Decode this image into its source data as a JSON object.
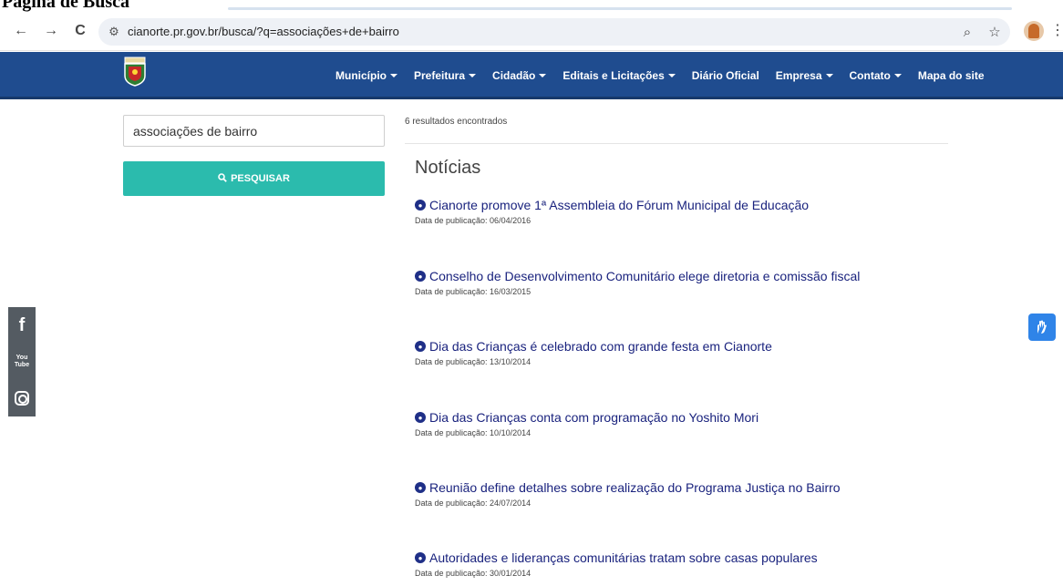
{
  "browser": {
    "tab_title": "Página de Busca",
    "url": "cianorte.pr.gov.br/busca/?q=associações+de+bairro",
    "back_icon": "←",
    "forward_icon": "→",
    "reload_icon": "C",
    "site_info_icon": "⚙",
    "zoom_icon": "⌕",
    "bookmark_icon": "☆",
    "menu_icon": "⋮"
  },
  "header": {
    "nav": [
      {
        "label": "Município",
        "dropdown": true
      },
      {
        "label": "Prefeitura",
        "dropdown": true
      },
      {
        "label": "Cidadão",
        "dropdown": true
      },
      {
        "label": "Editais e Licitações",
        "dropdown": true
      },
      {
        "label": "Diário Oficial",
        "dropdown": false
      },
      {
        "label": "Empresa",
        "dropdown": true
      },
      {
        "label": "Contato",
        "dropdown": true
      },
      {
        "label": "Mapa do site",
        "dropdown": false
      }
    ],
    "colors": {
      "bar": "#1f4c8f"
    }
  },
  "search": {
    "value": "associações de bairro",
    "button_label": "PESQUISAR",
    "button_color": "#2bbbad"
  },
  "results": {
    "count_text": "6 resultados encontrados",
    "section_title": "Notícias",
    "items": [
      {
        "title": "Cianorte promove 1ª Assembleia do Fórum Municipal de Educação",
        "date": "Data de publicação: 06/04/2016"
      },
      {
        "title": "Conselho de Desenvolvimento Comunitário elege diretoria e comissão fiscal",
        "date": "Data de publicação: 16/03/2015"
      },
      {
        "title": "Dia das Crianças é celebrado com grande festa em Cianorte",
        "date": "Data de publicação: 13/10/2014"
      },
      {
        "title": "Dia das Crianças conta com programação no Yoshito Mori",
        "date": "Data de publicação: 10/10/2014"
      },
      {
        "title": "Reunião define detalhes sobre realização do Programa Justiça no Bairro",
        "date": "Data de publicação: 24/07/2014"
      },
      {
        "title": "Autoridades e lideranças comunitárias tratam sobre casas populares",
        "date": "Data de publicação: 30/01/2014"
      }
    ]
  },
  "social": {
    "facebook_glyph": "f",
    "youtube_glyph_top": "You",
    "youtube_glyph_bottom": "Tube"
  },
  "accessibility": {
    "icon": "hand-sign-icon"
  }
}
